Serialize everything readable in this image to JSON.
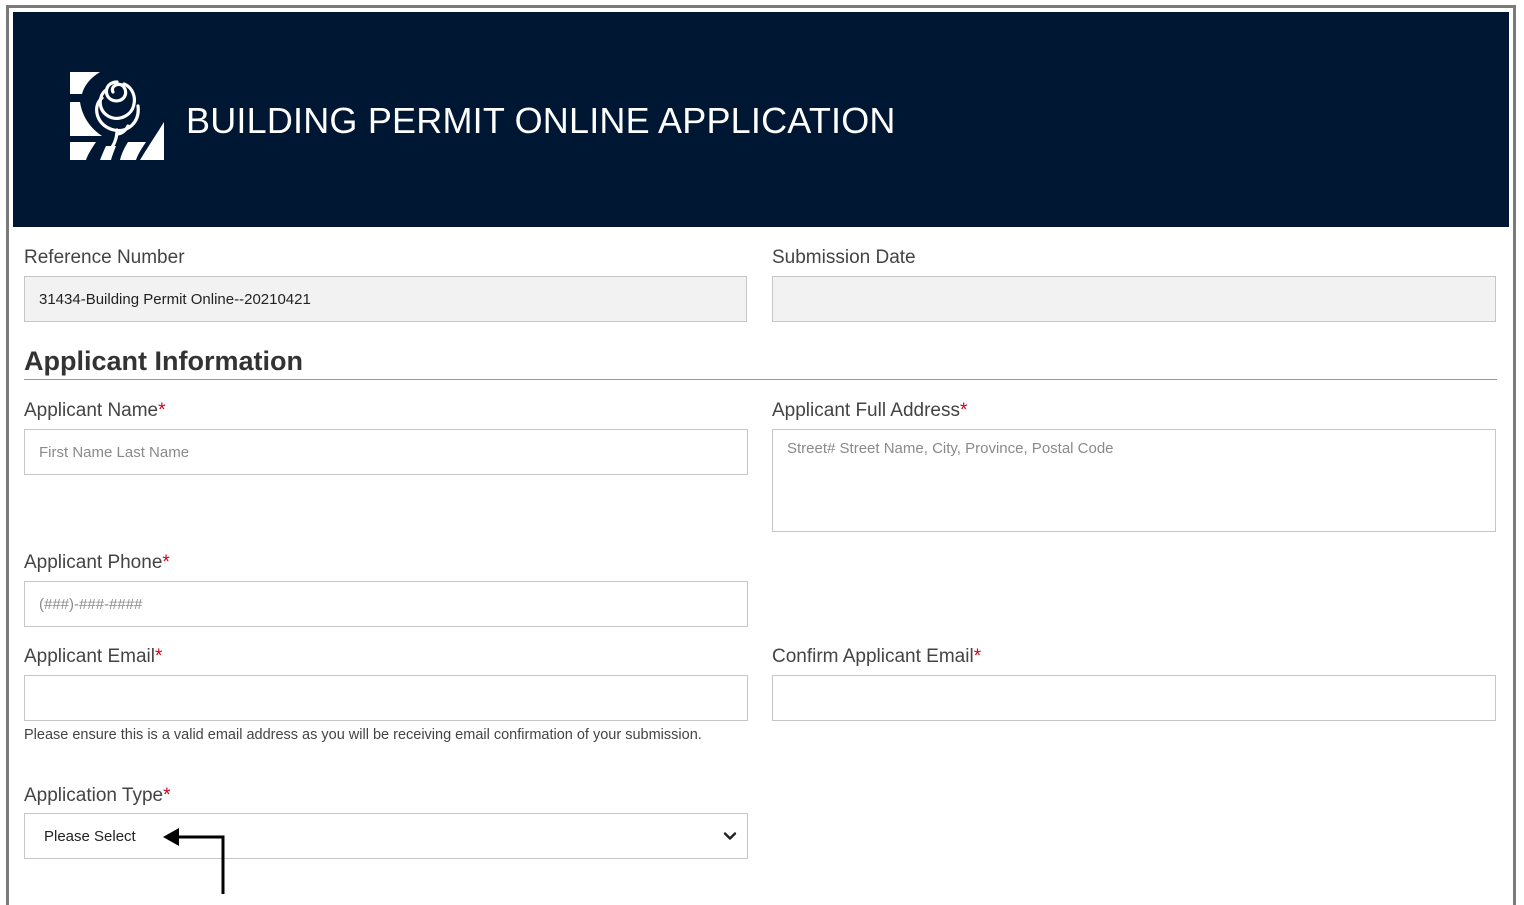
{
  "header": {
    "title": "BUILDING PERMIT ONLINE APPLICATION"
  },
  "reference": {
    "label": "Reference Number",
    "value": "31434-Building Permit Online--20210421"
  },
  "submission_date": {
    "label": "Submission Date",
    "value": ""
  },
  "section": {
    "title": "Applicant Information"
  },
  "required_marker": "*",
  "applicant_name": {
    "label": "Applicant Name",
    "placeholder": "First Name Last Name"
  },
  "applicant_address": {
    "label": "Applicant Full Address",
    "placeholder": "Street# Street Name, City, Province, Postal Code"
  },
  "applicant_phone": {
    "label": "Applicant Phone",
    "placeholder": "(###)-###-####"
  },
  "applicant_email": {
    "label": "Applicant Email",
    "value": "",
    "help": "Please ensure this is a valid email address as you will be receiving email confirmation of your submission."
  },
  "confirm_email": {
    "label": "Confirm Applicant Email",
    "value": ""
  },
  "application_type": {
    "label": "Application Type",
    "selected": "Please Select"
  },
  "colors": {
    "header_bg": "#001733",
    "required": "#d0021b",
    "readonly_bg": "#f2f2f2"
  },
  "icons": {
    "logo": "rose-logo-icon",
    "dropdown": "chevron-down-icon",
    "annotation": "arrow-left-icon"
  }
}
